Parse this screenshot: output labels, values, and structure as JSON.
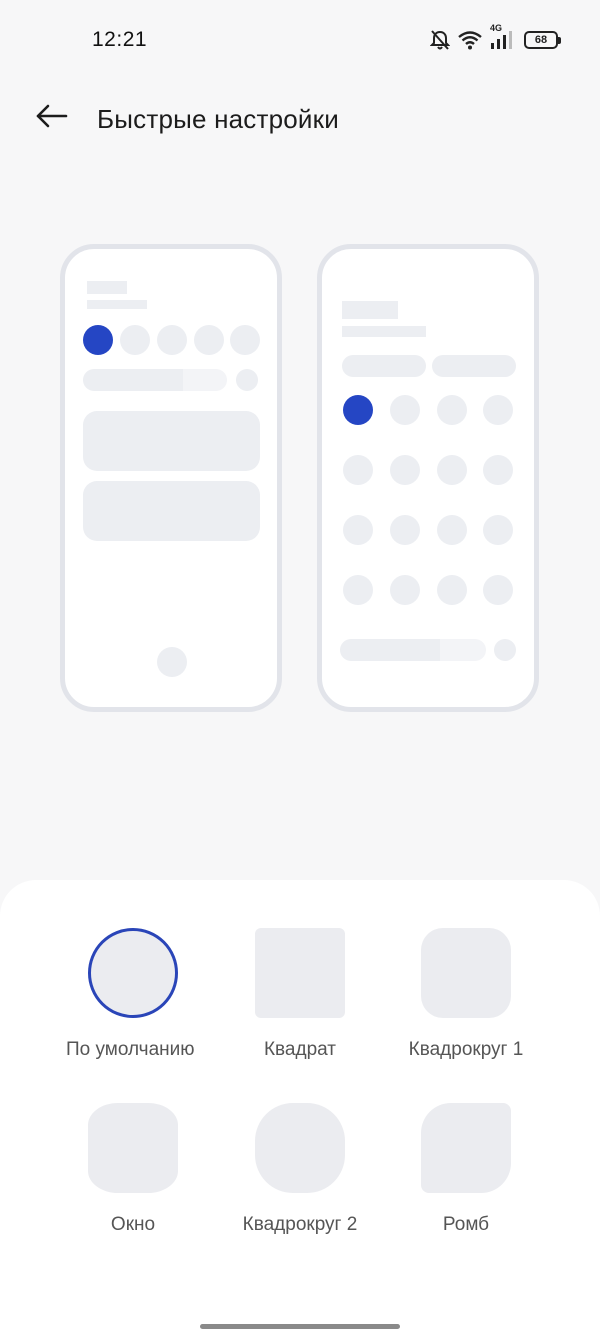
{
  "status_bar": {
    "time": "12:21",
    "network": "4G",
    "battery": "68",
    "icons": [
      "bell-off-icon",
      "wifi-icon",
      "signal-icon",
      "battery-icon"
    ]
  },
  "header": {
    "title": "Быстрые настройки",
    "back_icon": "arrow-left-icon"
  },
  "preview": {
    "accent_color": "#2546c4",
    "placeholder_color": "#eceef2"
  },
  "shapes": [
    {
      "label": "По умолчанию",
      "selected": true
    },
    {
      "label": "Квадрат",
      "selected": false
    },
    {
      "label": "Квадрокруг 1",
      "selected": false
    },
    {
      "label": "Окно",
      "selected": false
    },
    {
      "label": "Квадрокруг 2",
      "selected": false
    },
    {
      "label": "Ромб",
      "selected": false
    }
  ]
}
